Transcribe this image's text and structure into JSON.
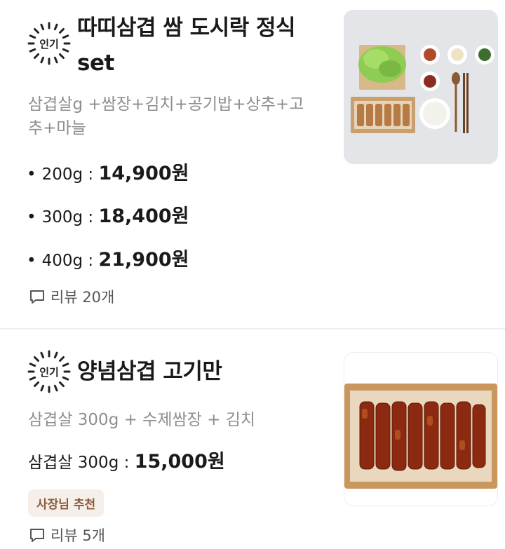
{
  "items": [
    {
      "badge": "인기",
      "title_line1": "따띠삼겹 쌈 도시락 정식",
      "title_line2": "set",
      "desc_line1": "삼겹살g +쌈장+김치+공기밥+상추+고",
      "desc_line2": "추+마늘",
      "prices": [
        {
          "bullet": "•",
          "label": "200g : ",
          "price": "14,900원"
        },
        {
          "bullet": "•",
          "label": "300g : ",
          "price": "18,400원"
        },
        {
          "bullet": "•",
          "label": "400g : ",
          "price": "21,900원"
        }
      ],
      "review": "리뷰 20개"
    },
    {
      "badge": "인기",
      "title": "양념삼겹 고기만",
      "desc": "삼겹살 300g + 수제쌈장 + 김치",
      "price_label": "삼겹살 300g : ",
      "price": "15,000원",
      "tag": "사장님 추천",
      "review": "리뷰 5개"
    }
  ],
  "icons": {
    "review": "speech-bubble-icon",
    "badge": "popular-sunburst-badge"
  },
  "colors": {
    "accent_tag_bg": "#f6eee8",
    "accent_tag_text": "#8a5a3c",
    "desc": "#8e8e8e"
  }
}
